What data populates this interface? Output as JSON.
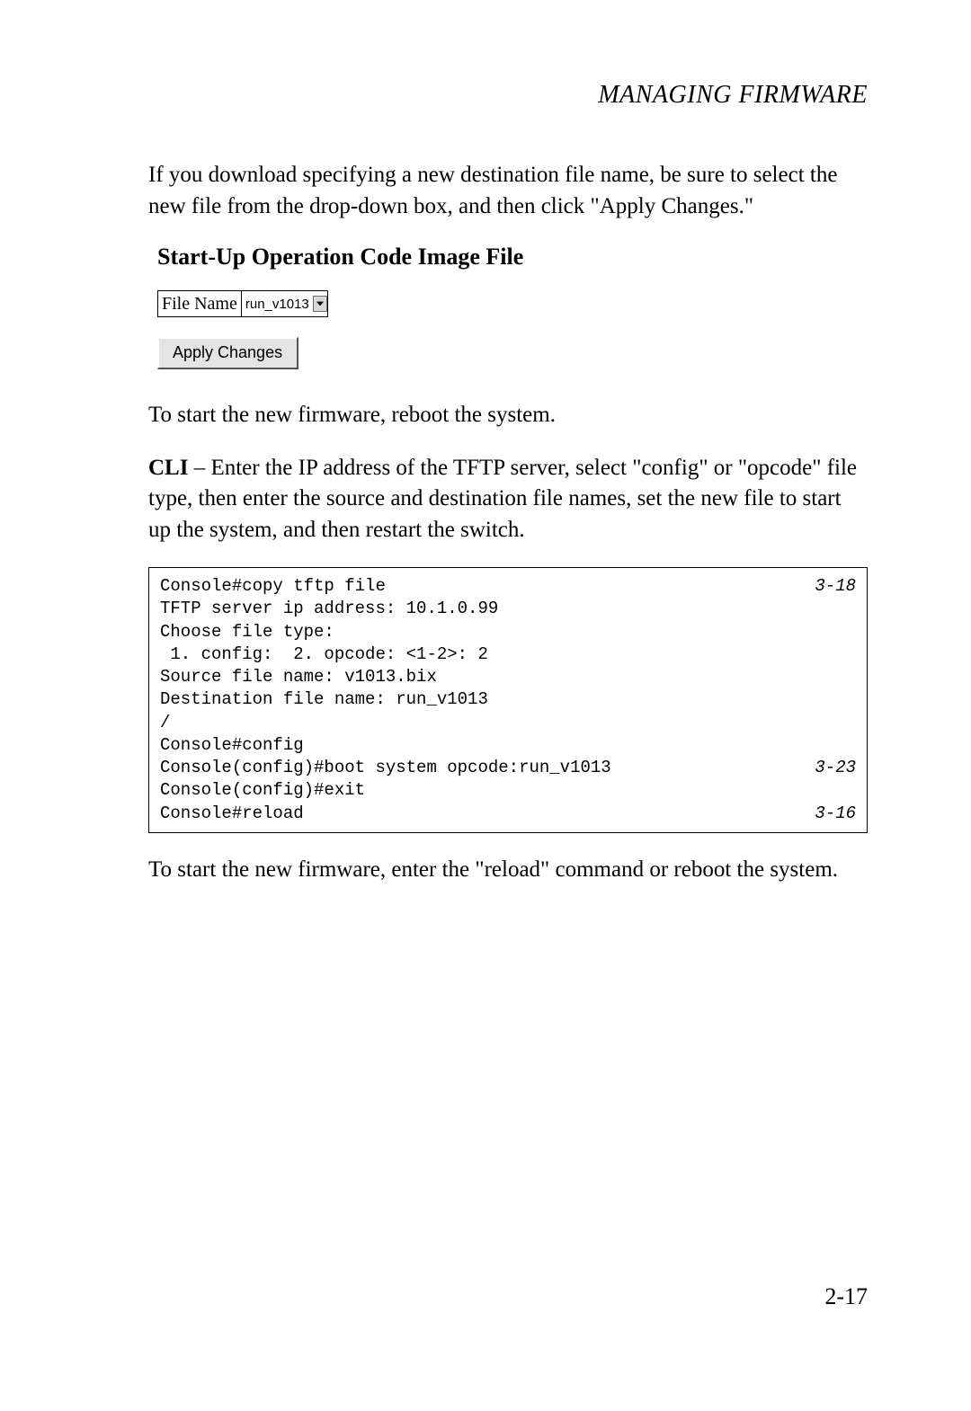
{
  "header": {
    "running_title": "MANAGING FIRMWARE"
  },
  "paragraphs": {
    "p1": "If you download specifying a new destination file name, be sure to select the new file from the drop-down box, and then click \"Apply Changes.\"",
    "p2": "To start the new firmware, reboot the system.",
    "p3_prefix": "CLI",
    "p3_rest": " – Enter the IP address of the TFTP server, select \"config\" or \"opcode\" file type, then enter the source and destination file names, set the new file to start up the system, and then restart the switch.",
    "p4": "To start the new firmware, enter the \"reload\" command or reboot the system."
  },
  "ui": {
    "section_title": "Start-Up Operation Code Image File",
    "file_name_label": "File Name",
    "file_name_value": "run_v1013",
    "apply_button": "Apply Changes"
  },
  "cli": {
    "lines": [
      {
        "text": "Console#copy tftp file",
        "ref": "3-18"
      },
      {
        "text": "TFTP server ip address: 10.1.0.99",
        "ref": ""
      },
      {
        "text": "Choose file type:",
        "ref": ""
      },
      {
        "text": " 1. config:  2. opcode: <1-2>: 2",
        "ref": ""
      },
      {
        "text": "Source file name: v1013.bix",
        "ref": ""
      },
      {
        "text": "Destination file name: run_v1013",
        "ref": ""
      },
      {
        "text": "/",
        "ref": ""
      },
      {
        "text": "Console#config",
        "ref": ""
      },
      {
        "text": "Console(config)#boot system opcode:run_v1013",
        "ref": "3-23"
      },
      {
        "text": "Console(config)#exit",
        "ref": ""
      },
      {
        "text": "Console#reload",
        "ref": "3-16"
      }
    ]
  },
  "footer": {
    "page_number": "2-17"
  }
}
